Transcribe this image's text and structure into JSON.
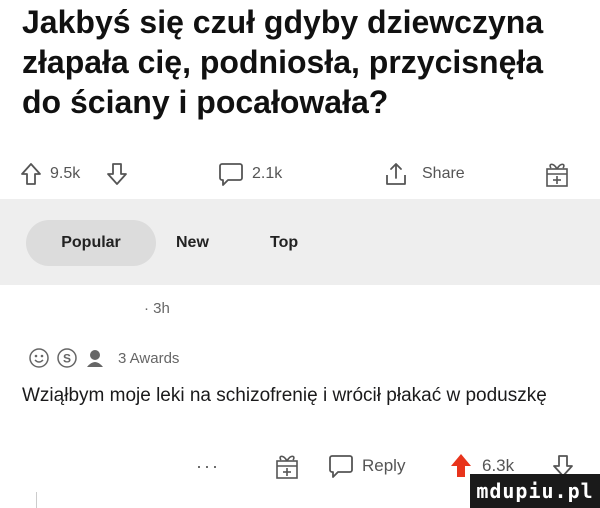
{
  "post": {
    "title": "Jakbyś się czuł gdyby dziewczyna złapała cię, podniosła, przycisnęła do ściany i pocałowała?",
    "score": "9.5k",
    "comments": "2.1k",
    "share_label": "Share"
  },
  "sort": {
    "tabs": [
      {
        "label": "Popular",
        "active": true
      },
      {
        "label": "New",
        "active": false
      },
      {
        "label": "Top",
        "active": false
      }
    ]
  },
  "comment": {
    "time": "· 3h",
    "awards_label": "3 Awards",
    "body": "Wziąłbym moje leki na schizofrenię i wrócił płakać w poduszkę",
    "more": "···",
    "reply_label": "Reply",
    "score": "6.3k"
  },
  "watermark": "mdupiu.pl",
  "colors": {
    "upvote_active": "#e8341c",
    "sort_bg": "#eeeeee",
    "active_tab_bg": "#dcdcdc"
  }
}
